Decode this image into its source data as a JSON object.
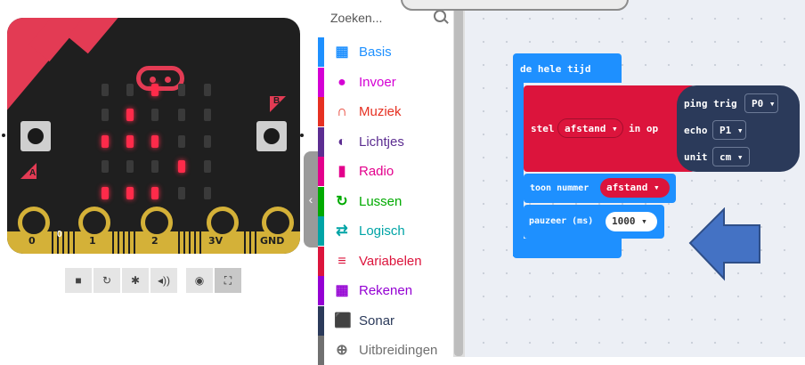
{
  "simulator": {
    "pins": [
      "0",
      "1",
      "2",
      "3V",
      "GND"
    ],
    "pin0_small": "0",
    "button_a": "A",
    "button_b": "B",
    "led_matrix": [
      [
        0,
        0,
        1,
        0,
        0
      ],
      [
        0,
        1,
        0,
        0,
        0
      ],
      [
        1,
        1,
        1,
        0,
        0
      ],
      [
        0,
        0,
        0,
        1,
        0
      ],
      [
        1,
        1,
        1,
        0,
        0
      ]
    ],
    "toolbar": [
      "stop-icon",
      "restart-icon",
      "debug-icon",
      "mute-icon",
      "screenshot-icon",
      "fullscreen-icon"
    ]
  },
  "toolbox": {
    "search_placeholder": "Zoeken...",
    "categories": [
      {
        "label": "Basis",
        "color": "#1e90ff",
        "icon": "grid-icon",
        "glyph": "▦"
      },
      {
        "label": "Invoer",
        "color": "#d400d4",
        "icon": "circle-icon",
        "glyph": "●"
      },
      {
        "label": "Muziek",
        "color": "#e63022",
        "icon": "headphones-icon",
        "glyph": "∩"
      },
      {
        "label": "Lichtjes",
        "color": "#5c2d91",
        "icon": "toggle-icon",
        "glyph": "◐"
      },
      {
        "label": "Radio",
        "color": "#e3008c",
        "icon": "signal-icon",
        "glyph": "▮"
      },
      {
        "label": "Lussen",
        "color": "#00aa00",
        "icon": "loop-icon",
        "glyph": "↻"
      },
      {
        "label": "Logisch",
        "color": "#00a4a6",
        "icon": "shuffle-icon",
        "glyph": "⇄"
      },
      {
        "label": "Variabelen",
        "color": "#dc143c",
        "icon": "list-icon",
        "glyph": "≡"
      },
      {
        "label": "Rekenen",
        "color": "#9400d3",
        "icon": "calculator-icon",
        "glyph": "▦"
      },
      {
        "label": "Sonar",
        "color": "#2b3a5a",
        "icon": "sonar-icon",
        "glyph": "⬛"
      },
      {
        "label": "Uitbreidingen",
        "color": "#707070",
        "icon": "plus-circle-icon",
        "glyph": "⊕"
      }
    ]
  },
  "workspace": {
    "forever_label": "de hele tijd",
    "set_label": "stel",
    "variable": "afstand",
    "in_op": "in op",
    "ping_label": "ping trig",
    "trig_value": "P0",
    "echo_label": "echo",
    "echo_value": "P1",
    "unit_label": "unit",
    "unit_value": "cm",
    "show_number_label": "toon nummer",
    "show_value": "afstand",
    "pause_label": "pauzeer (ms)",
    "pause_value": "1000",
    "colors": {
      "forever": "#1e90ff",
      "variable": "#dc143c",
      "sonar": "#2b3a5a",
      "arrow": "#4472c4"
    }
  }
}
